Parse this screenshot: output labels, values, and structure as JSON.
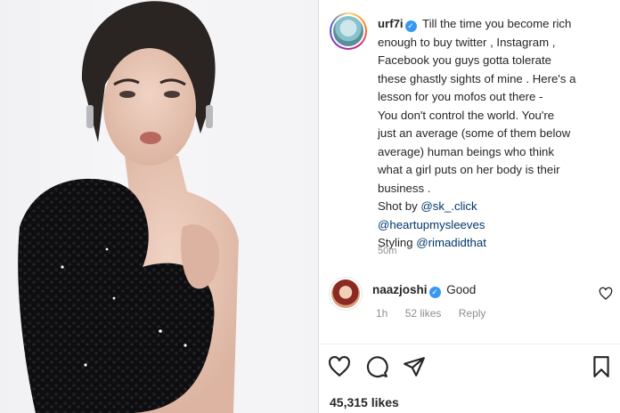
{
  "post": {
    "author": "urf7i",
    "verified_mark": "✓",
    "caption_lines": [
      "Till the time you become rich",
      "enough to buy twitter , Instagram ,",
      "Facebook you guys gotta tolerate",
      "these ghastly sights of mine . Here's a",
      "lesson for you mofos out there -",
      "You don't control the world. You're",
      "just an average (some of them below",
      "average) human beings who think",
      "what a girl puts on her body is their",
      "business ."
    ],
    "shot_by_label": "Shot by",
    "shot_by_mention": "@sk_.click",
    "mention_2": "@heartupmysleeves",
    "styling_label": "Styling",
    "styling_mention": "@rimadidthat",
    "timestamp": "50m",
    "likes": "45,315 likes"
  },
  "comment": {
    "author": "naazjoshi",
    "text": "Good",
    "time": "1h",
    "likes": "52 likes",
    "reply_label": "Reply"
  },
  "icons": {
    "like": "heart-icon",
    "comment": "comment-icon",
    "share": "paper-plane-icon",
    "save": "bookmark-icon"
  },
  "colors": {
    "mention": "#00376b",
    "verified": "#3897f0",
    "meta": "#8e8e8e"
  }
}
